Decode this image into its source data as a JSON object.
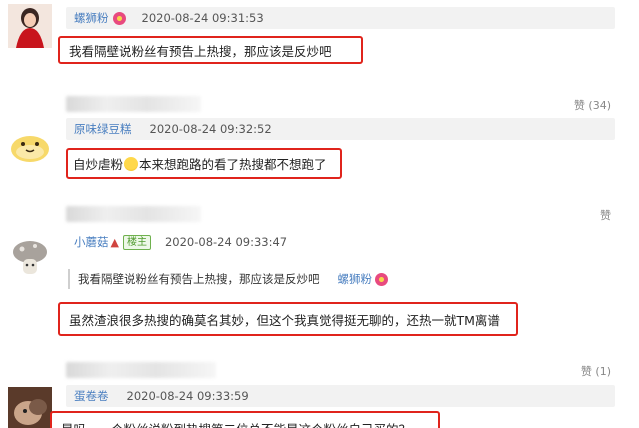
{
  "comments": [
    {
      "username": "螺狮粉",
      "time": "2020-08-24 09:31:53",
      "text": "我看隔壁说粉丝有预告上热搜，那应该是反炒吧",
      "likes": "赞 (34)"
    },
    {
      "username": "原味绿豆糕",
      "time": "2020-08-24 09:32:52",
      "text_before": "自炒虐粉",
      "text_after": "本来想跑路的看了热搜都不想跑了",
      "likes": "赞"
    },
    {
      "username": "小蘑菇",
      "badge": "楼主",
      "time": "2020-08-24 09:33:47",
      "quote_text": "我看隔壁说粉丝有预告上热搜，那应该是反炒吧",
      "quote_user": "螺狮粉",
      "text": "虽然渣浪很多热搜的确莫名其妙，但这个我真觉得挺无聊的，还热一就TM离谱",
      "likes": "赞 (1)"
    },
    {
      "username": "蛋卷卷",
      "time": "2020-08-24 09:33:59",
      "text": "是吗，一个粉丝说粉到热搜第二位总不能是这个粉丝自己买的？"
    }
  ],
  "colors": {
    "highlight": "#e0241c",
    "username": "#4a7fc0",
    "badge": "#4e9a2c"
  }
}
